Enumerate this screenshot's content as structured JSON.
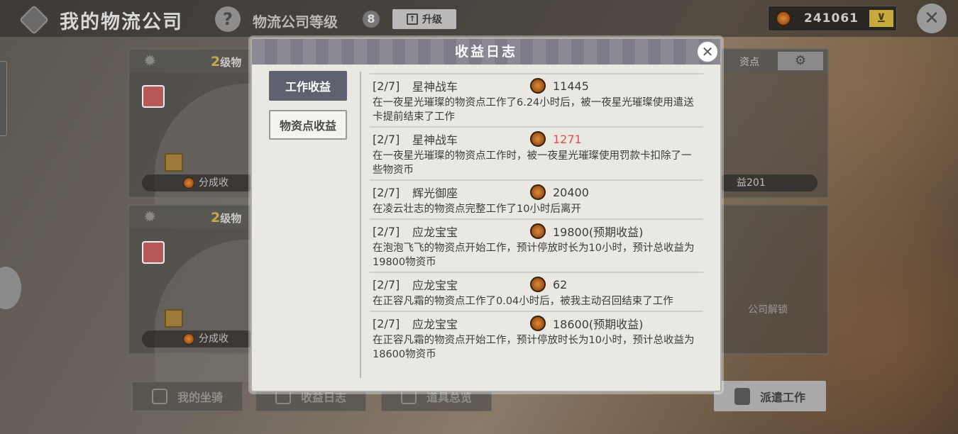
{
  "topbar": {
    "title": "我的物流公司",
    "help": "?",
    "level_label": "物流公司等级",
    "level_value": "8",
    "upgrade_label": "升级",
    "currency_value": "241061",
    "shop_icon": "cart-icon",
    "close": "✕"
  },
  "background": {
    "cards": [
      {
        "level_num": "2",
        "level_text": "级物",
        "footer": "分成收"
      },
      {
        "level_num": "2",
        "level_text": "级物",
        "footer": "分成收"
      }
    ],
    "right_top": {
      "header_label": "资点",
      "footer": "益201"
    },
    "right_bottom": {
      "text": "公司解锁"
    },
    "bottom_buttons": [
      "我的坐骑",
      "收益日志",
      "道具总览"
    ],
    "dispatch_label": "派遣工作"
  },
  "modal": {
    "title": "收益日志",
    "close": "✕",
    "tabs": [
      "工作收益",
      "物资点收益"
    ],
    "entries": [
      {
        "date": "[2/7]",
        "name": "星神战车",
        "amount": "11445",
        "negative": false,
        "desc": "在一夜星光璀璨的物资点工作了6.24小时后，被一夜星光璀璨使用遣送卡提前结束了工作"
      },
      {
        "date": "[2/7]",
        "name": "星神战车",
        "amount": "1271",
        "negative": true,
        "desc": "在一夜星光璀璨的物资点工作时，被一夜星光璀璨使用罚款卡扣除了一些物资币"
      },
      {
        "date": "[2/7]",
        "name": "辉光御座",
        "amount": "20400",
        "negative": false,
        "desc": "在凌云壮志的物资点完整工作了10小时后离开"
      },
      {
        "date": "[2/7]",
        "name": "应龙宝宝",
        "amount": "19800(预期收益)",
        "negative": false,
        "desc": "在泡泡飞飞的物资点开始工作，预计停放时长为10小时，预计总收益为19800物资币"
      },
      {
        "date": "[2/7]",
        "name": "应龙宝宝",
        "amount": "62",
        "negative": false,
        "desc": "在正容凡霜的物资点工作了0.04小时后，被我主动召回结束了工作"
      },
      {
        "date": "[2/7]",
        "name": "应龙宝宝",
        "amount": "18600(预期收益)",
        "negative": false,
        "desc": "在正容凡霜的物资点开始工作，预计停放时长为10小时，预计总收益为18600物资币"
      }
    ]
  }
}
